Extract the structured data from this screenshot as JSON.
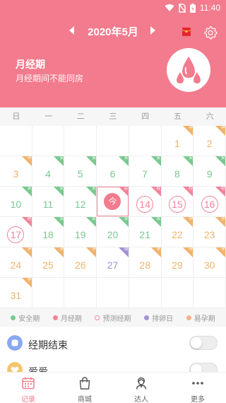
{
  "status_bar": {
    "time": "11:40"
  },
  "header": {
    "month_title": "2020年5月",
    "status_title": "月经期",
    "status_subtitle": "月经期间不能同房"
  },
  "weekdays": [
    "日",
    "一",
    "二",
    "三",
    "四",
    "五",
    "六"
  ],
  "calendar": {
    "today_label": "今",
    "corner_labels": {
      "safe": "安",
      "period": "经",
      "fertile": "孕",
      "ovulation": "排"
    },
    "cells": [
      {
        "col": 5,
        "row": 0,
        "day": "1",
        "color": "fert",
        "corner": "fert"
      },
      {
        "col": 6,
        "row": 0,
        "day": "2",
        "color": "fert",
        "corner": "fert"
      },
      {
        "col": 0,
        "row": 1,
        "day": "3",
        "color": "fert",
        "corner": "fert"
      },
      {
        "col": 1,
        "row": 1,
        "day": "4",
        "color": "safe",
        "corner": "safe"
      },
      {
        "col": 2,
        "row": 1,
        "day": "5",
        "color": "safe",
        "corner": "safe"
      },
      {
        "col": 3,
        "row": 1,
        "day": "6",
        "color": "safe",
        "corner": "safe"
      },
      {
        "col": 4,
        "row": 1,
        "day": "7",
        "color": "safe",
        "corner": "safe"
      },
      {
        "col": 5,
        "row": 1,
        "day": "8",
        "color": "safe",
        "corner": "safe"
      },
      {
        "col": 6,
        "row": 1,
        "day": "9",
        "color": "safe",
        "corner": "safe"
      },
      {
        "col": 0,
        "row": 2,
        "day": "10",
        "color": "safe",
        "corner": "safe"
      },
      {
        "col": 1,
        "row": 2,
        "day": "11",
        "color": "safe",
        "corner": "safe"
      },
      {
        "col": 2,
        "row": 2,
        "day": "12",
        "color": "safe",
        "corner": "safe"
      },
      {
        "col": 3,
        "row": 2,
        "day": "今",
        "today": true,
        "corner": "period"
      },
      {
        "col": 4,
        "row": 2,
        "day": "14",
        "color": "pred",
        "circle": true,
        "corner": "period"
      },
      {
        "col": 5,
        "row": 2,
        "day": "15",
        "color": "pred",
        "circle": true,
        "corner": "period"
      },
      {
        "col": 6,
        "row": 2,
        "day": "16",
        "color": "pred",
        "circle": true,
        "corner": "period"
      },
      {
        "col": 0,
        "row": 3,
        "day": "17",
        "color": "pred",
        "circle": true,
        "corner": "period"
      },
      {
        "col": 1,
        "row": 3,
        "day": "18",
        "color": "safe",
        "corner": "safe"
      },
      {
        "col": 2,
        "row": 3,
        "day": "19",
        "color": "safe",
        "corner": "safe"
      },
      {
        "col": 3,
        "row": 3,
        "day": "20",
        "color": "safe",
        "corner": "safe"
      },
      {
        "col": 4,
        "row": 3,
        "day": "21",
        "color": "safe",
        "corner": "safe"
      },
      {
        "col": 5,
        "row": 3,
        "day": "22",
        "color": "fert",
        "corner": "fert"
      },
      {
        "col": 6,
        "row": 3,
        "day": "23",
        "color": "fert",
        "corner": "fert"
      },
      {
        "col": 0,
        "row": 4,
        "day": "24",
        "color": "fert",
        "corner": "fert"
      },
      {
        "col": 1,
        "row": 4,
        "day": "25",
        "color": "fert",
        "corner": "fert"
      },
      {
        "col": 2,
        "row": 4,
        "day": "26",
        "color": "fert",
        "corner": "fert"
      },
      {
        "col": 3,
        "row": 4,
        "day": "27",
        "color": "ovu",
        "corner": "ovu"
      },
      {
        "col": 4,
        "row": 4,
        "day": "28",
        "color": "fert",
        "corner": "fert"
      },
      {
        "col": 5,
        "row": 4,
        "day": "29",
        "color": "fert",
        "corner": "fert"
      },
      {
        "col": 6,
        "row": 4,
        "day": "30",
        "color": "fert",
        "corner": "fert"
      },
      {
        "col": 0,
        "row": 5,
        "day": "31",
        "color": "fert",
        "corner": "fert"
      }
    ]
  },
  "legend": {
    "safe": "安全期",
    "period": "月经期",
    "predicted": "预测经期",
    "ovulation": "排卵日",
    "fertile": "易孕期"
  },
  "options": {
    "period_end": "经期结束",
    "love": "爱爱"
  },
  "tabs": {
    "record": "记录",
    "shop": "商城",
    "expert": "达人",
    "more": "更多"
  },
  "colors": {
    "accent": "#f27b8d",
    "safe": "#79c98e",
    "period": "#f0849a",
    "fertile": "#f0b36d",
    "ovulation": "#a592d6"
  }
}
